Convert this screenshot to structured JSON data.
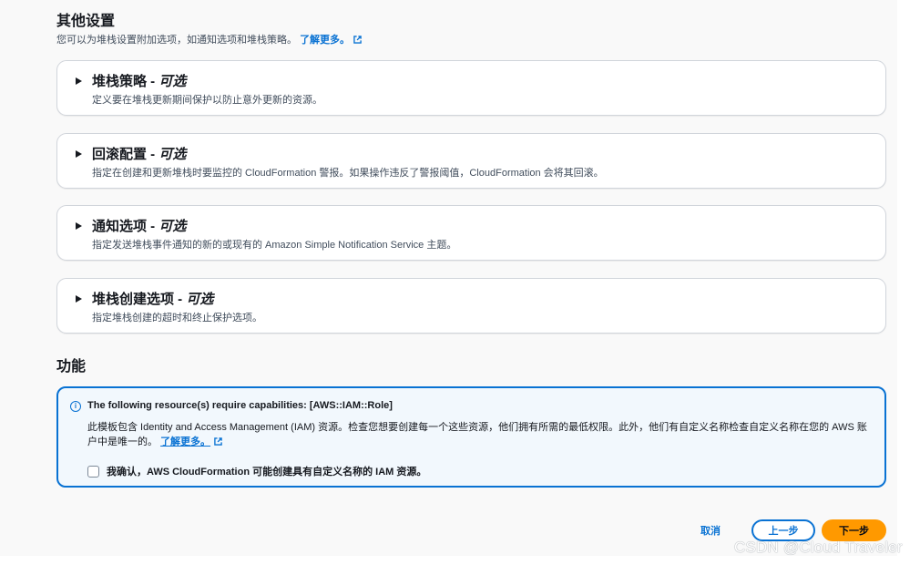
{
  "header": {
    "title": "其他设置",
    "description": "您可以为堆栈设置附加选项，如通知选项和堆栈策略。",
    "learn_more": "了解更多。"
  },
  "panels": [
    {
      "title": "堆栈策略 - ",
      "optional": "可选",
      "description": "定义要在堆栈更新期间保护以防止意外更新的资源。"
    },
    {
      "title": "回滚配置 - ",
      "optional": "可选",
      "description": "指定在创建和更新堆栈时要监控的 CloudFormation 警报。如果操作违反了警报阈值，CloudFormation 会将其回滚。"
    },
    {
      "title": "通知选项 - ",
      "optional": "可选",
      "description": "指定发送堆栈事件通知的新的或现有的 Amazon Simple Notification Service 主题。"
    },
    {
      "title": "堆栈创建选项 - ",
      "optional": "可选",
      "description": "指定堆栈创建的超时和终止保护选项。"
    }
  ],
  "capabilities": {
    "section_title": "功能",
    "alert_title": "The following resource(s) require capabilities: [AWS::IAM::Role]",
    "alert_body": "此模板包含 Identity and Access Management (IAM) 资源。检查您想要创建每一个这些资源，他们拥有所需的最低权限。此外，他们有自定义名称检查自定义名称在您的 AWS 账户中是唯一的。",
    "learn_more": "了解更多。",
    "checkbox_label": "我确认，AWS CloudFormation 可能创建具有自定义名称的 IAM 资源。",
    "checkbox_checked": false
  },
  "footer": {
    "cancel": "取消",
    "previous": "上一步",
    "next": "下一步"
  },
  "watermark": "CSDN @Cloud Traveler",
  "colors": {
    "link": "#0972d3",
    "primary_button": "#ff9900",
    "alert_bg": "#f2f8fd",
    "text": "#16191f"
  }
}
